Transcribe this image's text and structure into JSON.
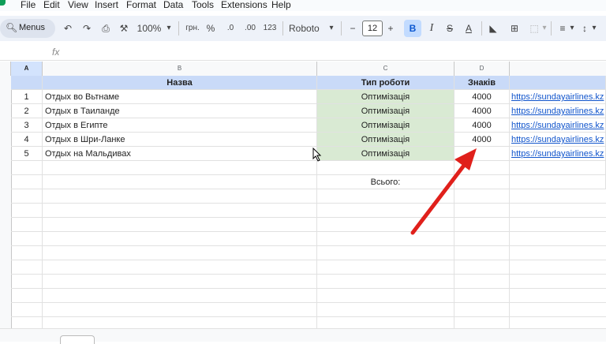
{
  "menu": {
    "items": [
      "File",
      "Edit",
      "View",
      "Insert",
      "Format",
      "Data",
      "Tools",
      "Extensions",
      "Help"
    ]
  },
  "toolbar": {
    "search_label": "Menus",
    "zoom": "100%",
    "currency": "грн.",
    "percent": "%",
    "decrease_decimal": ".0",
    "increase_decimal": ".00",
    "number_format": "123",
    "font": "Roboto",
    "font_size": "12",
    "bold": "B",
    "italic": "I"
  },
  "formula_bar": {
    "fx_label": "fx",
    "value": ""
  },
  "columns": {
    "selected_row_col": "A",
    "letters": [
      "A",
      "B",
      "C",
      "D"
    ]
  },
  "table": {
    "headers": {
      "b": "Назва",
      "c": "Тип роботи",
      "d": "Знаків"
    },
    "rows": [
      {
        "num": "1",
        "name": "Отдых во Вьтнаме",
        "type": "Оптимізація",
        "chars": "4000",
        "link": "https://sundayairlines.kz"
      },
      {
        "num": "2",
        "name": "Отдых в Таиланде",
        "type": "Оптимізація",
        "chars": "4000",
        "link": "https://sundayairlines.kz"
      },
      {
        "num": "3",
        "name": "Отдых в Египте",
        "type": "Оптимізація",
        "chars": "4000",
        "link": "https://sundayairlines.kz"
      },
      {
        "num": "4",
        "name": "Отдых в Шри-Ланке",
        "type": "Оптимізація",
        "chars": "4000",
        "link": "https://sundayairlines.kz"
      },
      {
        "num": "5",
        "name": "Отдых на Мальдивах",
        "type": "Оптимізація",
        "chars": "",
        "link": "https://sundayairlines.kz"
      }
    ],
    "total_label": "Всього:"
  },
  "colors": {
    "header_fill": "#c9daf8",
    "type_fill": "#d9ead3",
    "link": "#1155cc",
    "arrow": "#e0201b",
    "accent": "#0b57d0"
  }
}
